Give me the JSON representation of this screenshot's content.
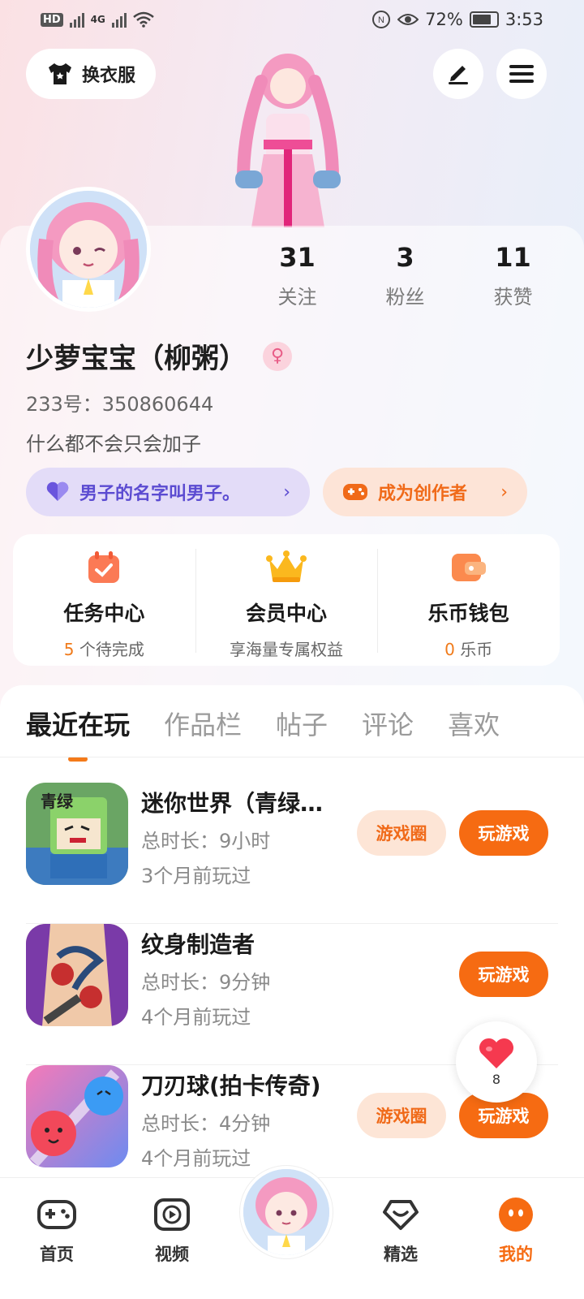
{
  "status_bar": {
    "network_chip": "HD",
    "network_type": "4G",
    "battery_percent": "72%",
    "time": "3:53"
  },
  "header": {
    "outfit_label": "换衣服"
  },
  "profile": {
    "nickname": "少萝宝宝（柳粥）",
    "uid": "233号：350860644",
    "bio": "什么都不会只会加子",
    "gender_symbol": "♀",
    "stats": [
      {
        "value": "31",
        "label": "关注"
      },
      {
        "value": "3",
        "label": "粉丝"
      },
      {
        "value": "11",
        "label": "获赞"
      }
    ],
    "title_pill": "男子的名字叫男子。",
    "creator_pill": "成为创作者"
  },
  "services": [
    {
      "title": "任务中心",
      "count": "5",
      "suffix": " 个待完成"
    },
    {
      "title": "会员中心",
      "sub": "享海量专属权益"
    },
    {
      "title": "乐币钱包",
      "count": "0",
      "suffix": " 乐币"
    }
  ],
  "tabs": [
    "最近在玩",
    "作品栏",
    "帖子",
    "评论",
    "喜欢"
  ],
  "games": [
    {
      "name": "迷你世界（青绿…",
      "playtime": "总时长：9小时",
      "last_played": "3个月前玩过",
      "circle_label": "游戏圈",
      "play_label": "玩游戏"
    },
    {
      "name": "纹身制造者",
      "playtime": "总时长：9分钟",
      "last_played": "4个月前玩过",
      "play_label": "玩游戏"
    },
    {
      "name": "刀刃球(拍卡传奇)",
      "playtime": "总时长：4分钟",
      "last_played": "4个月前玩过",
      "circle_label": "游戏圈",
      "play_label": "玩游戏"
    }
  ],
  "float_like": {
    "count": "8"
  },
  "bottom_nav": [
    {
      "label": "首页"
    },
    {
      "label": "视频"
    },
    {
      "label": "精选"
    },
    {
      "label": "我的"
    }
  ],
  "colors": {
    "accent": "#f66b12",
    "accent_soft": "#fde5d6",
    "title_pill_bg": "#e3dcf8",
    "title_pill_text": "#5b4bd1"
  }
}
